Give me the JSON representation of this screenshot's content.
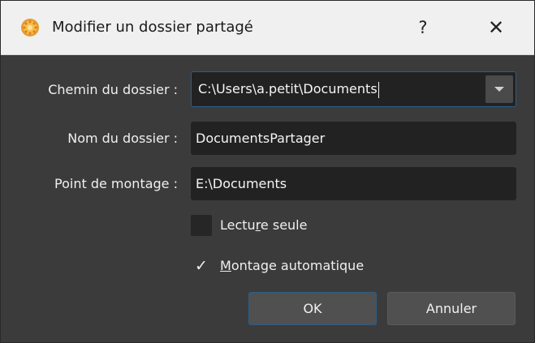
{
  "window": {
    "title": "Modifier un dossier partagé",
    "help_label": "?",
    "close_label": "✕",
    "icon": "virtualbox-gear-icon",
    "accent_color": "#2c5e86"
  },
  "form": {
    "folder_path": {
      "label": "Chemin du dossier :",
      "value": "C:\\Users\\a.petit\\Documents"
    },
    "folder_name": {
      "label": "Nom du dossier :",
      "value": "DocumentsPartager"
    },
    "mount_point": {
      "label": "Point de montage :",
      "value": "E:\\Documents"
    },
    "read_only": {
      "label_pre": "Lectu",
      "label_mnemonic": "r",
      "label_post": "e seule",
      "checked": false
    },
    "auto_mount": {
      "check_mark": "✓",
      "label_mnemonic": "M",
      "label_post": "ontage automatique",
      "checked": true
    }
  },
  "buttons": {
    "ok": "OK",
    "cancel": "Annuler"
  }
}
